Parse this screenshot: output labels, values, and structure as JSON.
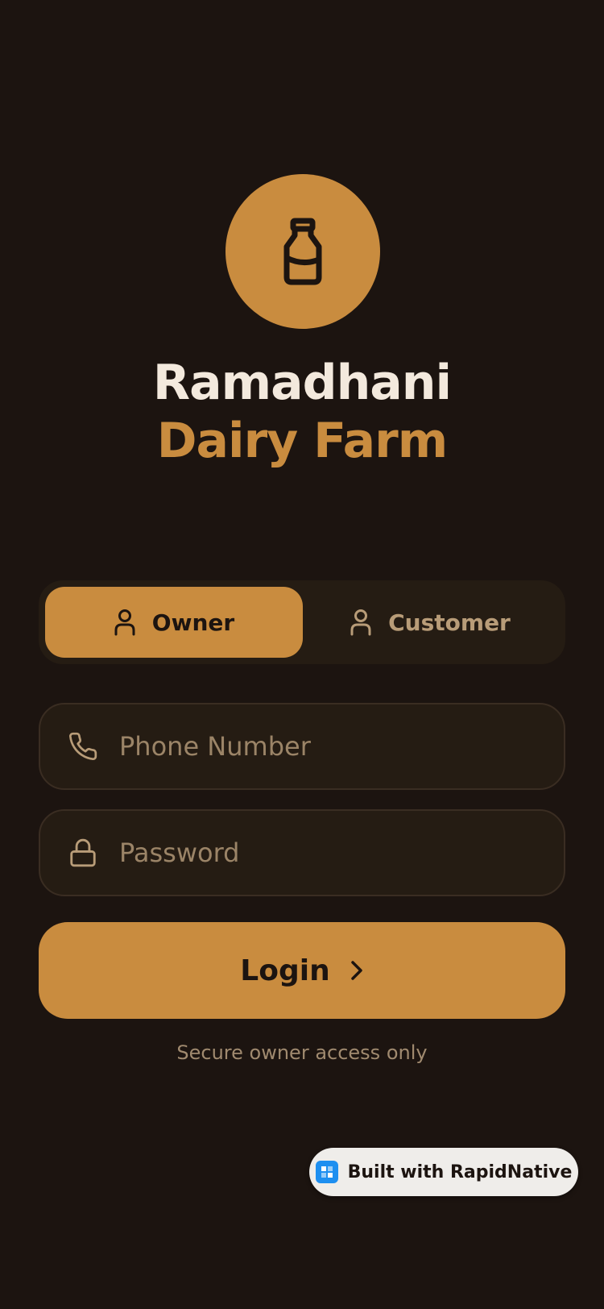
{
  "brand": {
    "title_line1": "Ramadhani",
    "title_line2": "Dairy Farm",
    "logo_icon": "milk-bottle-icon"
  },
  "role_toggle": {
    "options": [
      {
        "label": "Owner",
        "icon": "user-icon",
        "selected": true
      },
      {
        "label": "Customer",
        "icon": "user-icon",
        "selected": false
      }
    ]
  },
  "form": {
    "phone": {
      "placeholder": "Phone Number",
      "value": "",
      "icon": "phone-icon"
    },
    "password": {
      "placeholder": "Password",
      "value": "",
      "icon": "lock-icon"
    },
    "login_label": "Login",
    "login_icon": "chevron-right-icon",
    "note": "Secure owner access only"
  },
  "badge": {
    "label": "Built with RapidNative"
  },
  "colors": {
    "background": "#1c1410",
    "accent": "#c98c3f",
    "surface": "#251c13",
    "text_light": "#f3e9dd",
    "text_muted": "#b89c78"
  }
}
